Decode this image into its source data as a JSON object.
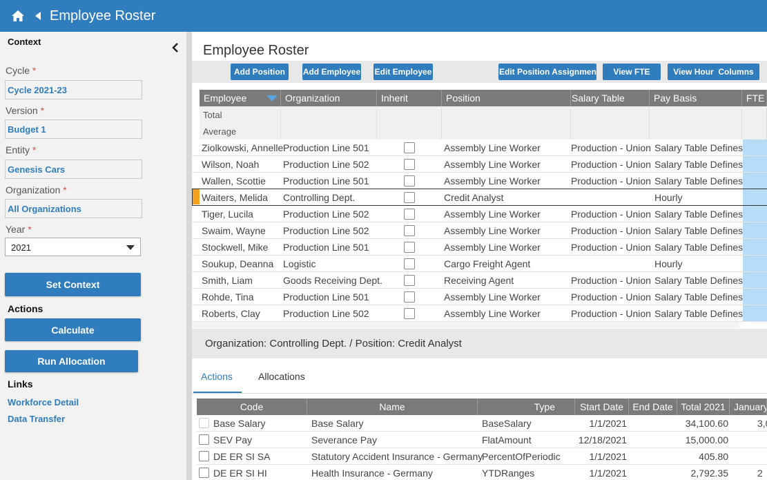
{
  "app": {
    "title": "Employee Roster"
  },
  "context": {
    "heading": "Context",
    "cycle_label": "Cycle",
    "cycle_value": "Cycle 2021-23",
    "version_label": "Version",
    "version_value": "Budget 1",
    "entity_label": "Entity",
    "entity_value": "Genesis Cars",
    "organization_label": "Organization",
    "organization_value": "All Organizations",
    "year_label": "Year",
    "year_value": "2021",
    "required_mark": "*",
    "set_context": "Set Context"
  },
  "actions": {
    "heading": "Actions",
    "calculate": "Calculate",
    "run_allocation": "Run Allocation"
  },
  "links": {
    "heading": "Links",
    "items": [
      "Workforce Detail",
      "Data Transfer"
    ]
  },
  "main": {
    "title": "Employee Roster"
  },
  "toolbar": {
    "add_position": "Add Position",
    "add_employee": "Add Employee",
    "edit_employee": "Edit Employee",
    "edit_position_assignment": "Edit Position Assignmen",
    "view_fte": "View FTE",
    "view_hour_columns": "View Hour  Columns"
  },
  "grid": {
    "columns": [
      "Employee",
      "Organization",
      "Inherit",
      "Position",
      "Salary Table",
      "Pay Basis",
      "FTE"
    ],
    "summary": [
      "Total",
      "Average"
    ],
    "rows": [
      [
        "Ziolkowski, Annelle",
        "Production Line 501",
        "Assembly Line Worker",
        "Production - Union",
        "Salary Table Defines"
      ],
      [
        "Wilson, Noah",
        "Production Line 502",
        "Assembly Line Worker",
        "Production - Union",
        "Salary Table Defines"
      ],
      [
        "Wallen, Scottie",
        "Production Line 501",
        "Assembly Line Worker",
        "Production - Union",
        "Salary Table Defines"
      ],
      [
        "Waiters, Melida",
        "Controlling Dept.",
        "Credit Analyst",
        "",
        "Hourly"
      ],
      [
        "Tiger, Lucila",
        "Production Line 502",
        "Assembly Line Worker",
        "Production - Union",
        "Salary Table Defines"
      ],
      [
        "Swaim, Wayne",
        "Production Line 502",
        "Assembly Line Worker",
        "Production - Union",
        "Salary Table Defines"
      ],
      [
        "Stockwell, Mike",
        "Production Line 501",
        "Assembly Line Worker",
        "Production - Union",
        "Salary Table Defines"
      ],
      [
        "Soukup, Deanna",
        "Logistic",
        "Cargo Freight Agent",
        "",
        "Hourly"
      ],
      [
        "Smith, Liam",
        "Goods Receiving Dept.",
        "Receiving Agent",
        "Production - Union",
        "Salary Table Defines"
      ],
      [
        "Rohde, Tina",
        "Production Line 501",
        "Assembly Line Worker",
        "Production - Union",
        "Salary Table Defines"
      ],
      [
        "Roberts, Clay",
        "Production Line 502",
        "Assembly Line Worker",
        "Production - Union",
        "Salary Table Defines"
      ]
    ]
  },
  "detail": {
    "header": "Organization: Controlling Dept. / Position: Credit Analyst",
    "tabs": [
      "Actions",
      "Allocations"
    ],
    "columns": [
      "Code",
      "Name",
      "Type",
      "Start Date",
      "End Date",
      "Total 2021",
      "January"
    ],
    "rows": [
      [
        "Base Salary",
        "Base Salary",
        "BaseSalary",
        "1/1/2021",
        "",
        "34,100.60",
        "3,0"
      ],
      [
        "SEV Pay",
        "Severance Pay",
        "FlatAmount",
        "12/18/2021",
        "",
        "15,000.00",
        ""
      ],
      [
        "DE ER SI SA",
        "Statutory Accident Insurance - Germany",
        "PercentOfPeriodic",
        "1/1/2021",
        "",
        "405.80",
        ""
      ],
      [
        "DE ER SI HI",
        "Health Insurance - Germany",
        "YTDRanges",
        "1/1/2021",
        "",
        "2,792.35",
        "2"
      ]
    ]
  },
  "colors": {
    "brand": "#2f7dbd",
    "header_gray": "#7a7a7a",
    "fte_fill": "#b8dcf8",
    "marker": "#f4a020"
  }
}
